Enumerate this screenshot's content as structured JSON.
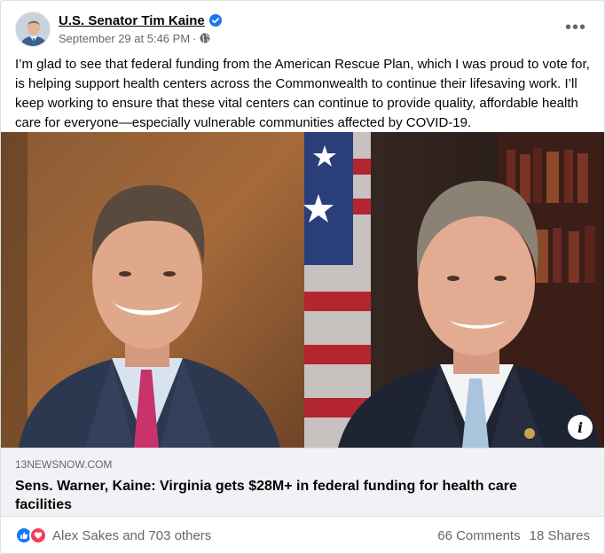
{
  "post": {
    "author": "U.S. Senator Tim Kaine",
    "date": "September 29 at 5:46 PM",
    "dot": "·",
    "more_label": "•••",
    "text": "I’m glad to see that federal funding from the American Rescue Plan, which I was proud to vote for, is helping support health centers across the Commonwealth to continue their lifesaving work. I’ll keep working to ensure that these vital centers can continue to provide quality, affordable health care for everyone—especially vulnerable communities affected by COVID-19."
  },
  "link": {
    "domain": "13NEWSNOW.COM",
    "title": "Sens. Warner, Kaine: Virginia gets $28M+ in federal funding for health care facilities",
    "info_label": "i"
  },
  "engagement": {
    "reactors": "Alex Sakes and 703 others",
    "comments": "66 Comments",
    "shares": "18 Shares"
  },
  "colors": {
    "facebook_blue": "#1877f2",
    "love_red": "#f33e58",
    "secondary_text": "#65676b"
  },
  "icons": {
    "verified": "verified-badge-icon",
    "audience": "globe-icon",
    "like": "like-icon",
    "love": "love-icon"
  }
}
